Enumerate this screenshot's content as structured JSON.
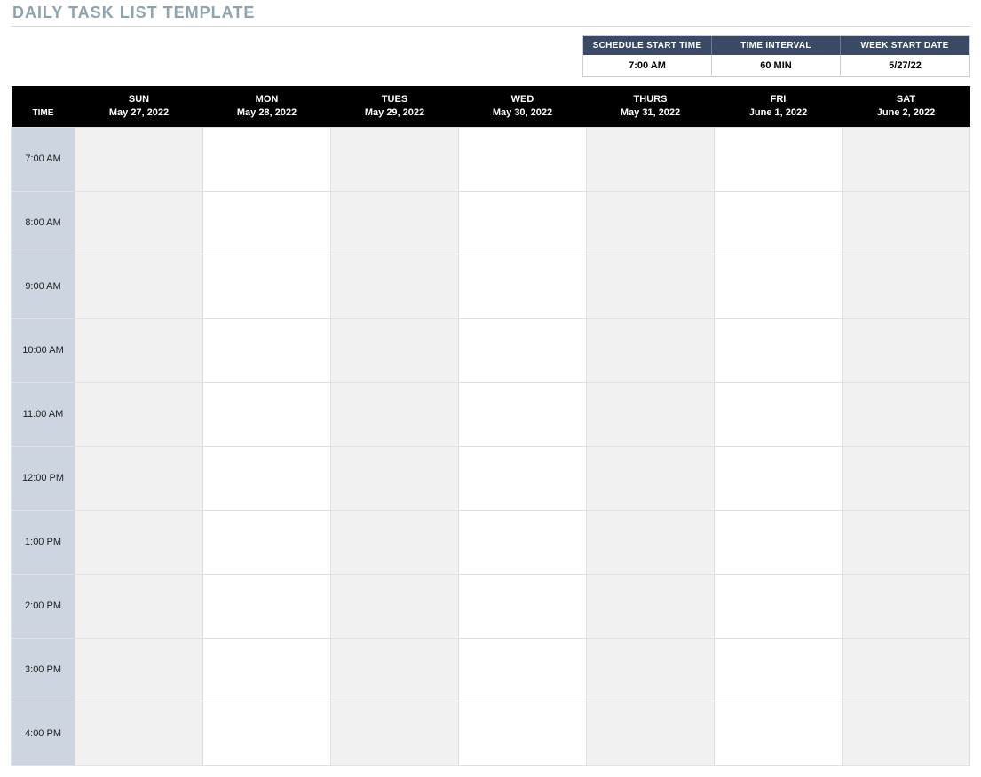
{
  "title": "DAILY TASK LIST TEMPLATE",
  "settings": {
    "headers": [
      "SCHEDULE START TIME",
      "TIME INTERVAL",
      "WEEK START DATE"
    ],
    "values": [
      "7:00 AM",
      "60 MIN",
      "5/27/22"
    ]
  },
  "schedule": {
    "time_header": "TIME",
    "days": [
      {
        "name": "SUN",
        "date": "May 27, 2022"
      },
      {
        "name": "MON",
        "date": "May 28, 2022"
      },
      {
        "name": "TUES",
        "date": "May 29, 2022"
      },
      {
        "name": "WED",
        "date": "May 30, 2022"
      },
      {
        "name": "THURS",
        "date": "May 31, 2022"
      },
      {
        "name": "FRI",
        "date": "June 1, 2022"
      },
      {
        "name": "SAT",
        "date": "June 2, 2022"
      }
    ],
    "times": [
      "7:00 AM",
      "8:00 AM",
      "9:00 AM",
      "10:00 AM",
      "11:00 AM",
      "12:00 PM",
      "1:00 PM",
      "2:00 PM",
      "3:00 PM",
      "4:00 PM"
    ],
    "shaded_columns": [
      0,
      2,
      4,
      6
    ]
  }
}
